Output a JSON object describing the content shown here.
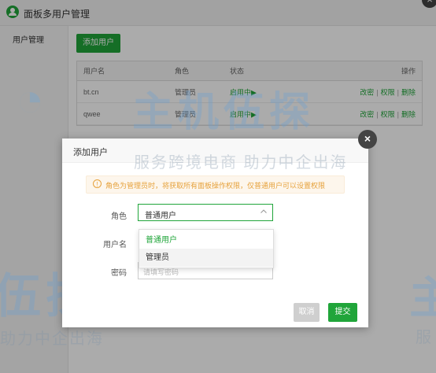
{
  "window": {
    "title": "面板多用户管理",
    "close_glyph": "×"
  },
  "sidebar": {
    "items": [
      {
        "label": "用户管理"
      }
    ]
  },
  "main": {
    "add_button": "添加用户",
    "table": {
      "columns": [
        "用户名",
        "角色",
        "状态",
        "操作"
      ],
      "rows": [
        {
          "username": "bt.cn",
          "role": "管理员",
          "status": "启用中▶",
          "actions": [
            "改密",
            "权限",
            "删除"
          ]
        },
        {
          "username": "qwee",
          "role": "管理员",
          "status": "启用中▶",
          "actions": [
            "改密",
            "权限",
            "删除"
          ]
        }
      ],
      "separator": "|"
    }
  },
  "watermark": {
    "brand": "主机伍探",
    "brand_partial": "伍探",
    "brand_edge": "主",
    "slogan": "服务跨境电商 助力中企出海",
    "slogan_partial": "助力中企出海",
    "slogan_edge": "服"
  },
  "dialog": {
    "title": "添加用户",
    "close_glyph": "×",
    "notice": {
      "icon": "info-circle-icon",
      "text": "角色为管理员时，将获取所有面板操作权限，仅普通用户可以设置权限"
    },
    "form": {
      "role_label": "角色",
      "role_value": "普通用户",
      "role_options": [
        "普通用户",
        "管理员"
      ],
      "username_label": "用户名",
      "password_label": "密码",
      "password_placeholder": "请填写密码"
    },
    "cancel_label": "取消",
    "submit_label": "提交"
  },
  "colors": {
    "accent": "#20a53a",
    "warning": "#e6a23c"
  }
}
